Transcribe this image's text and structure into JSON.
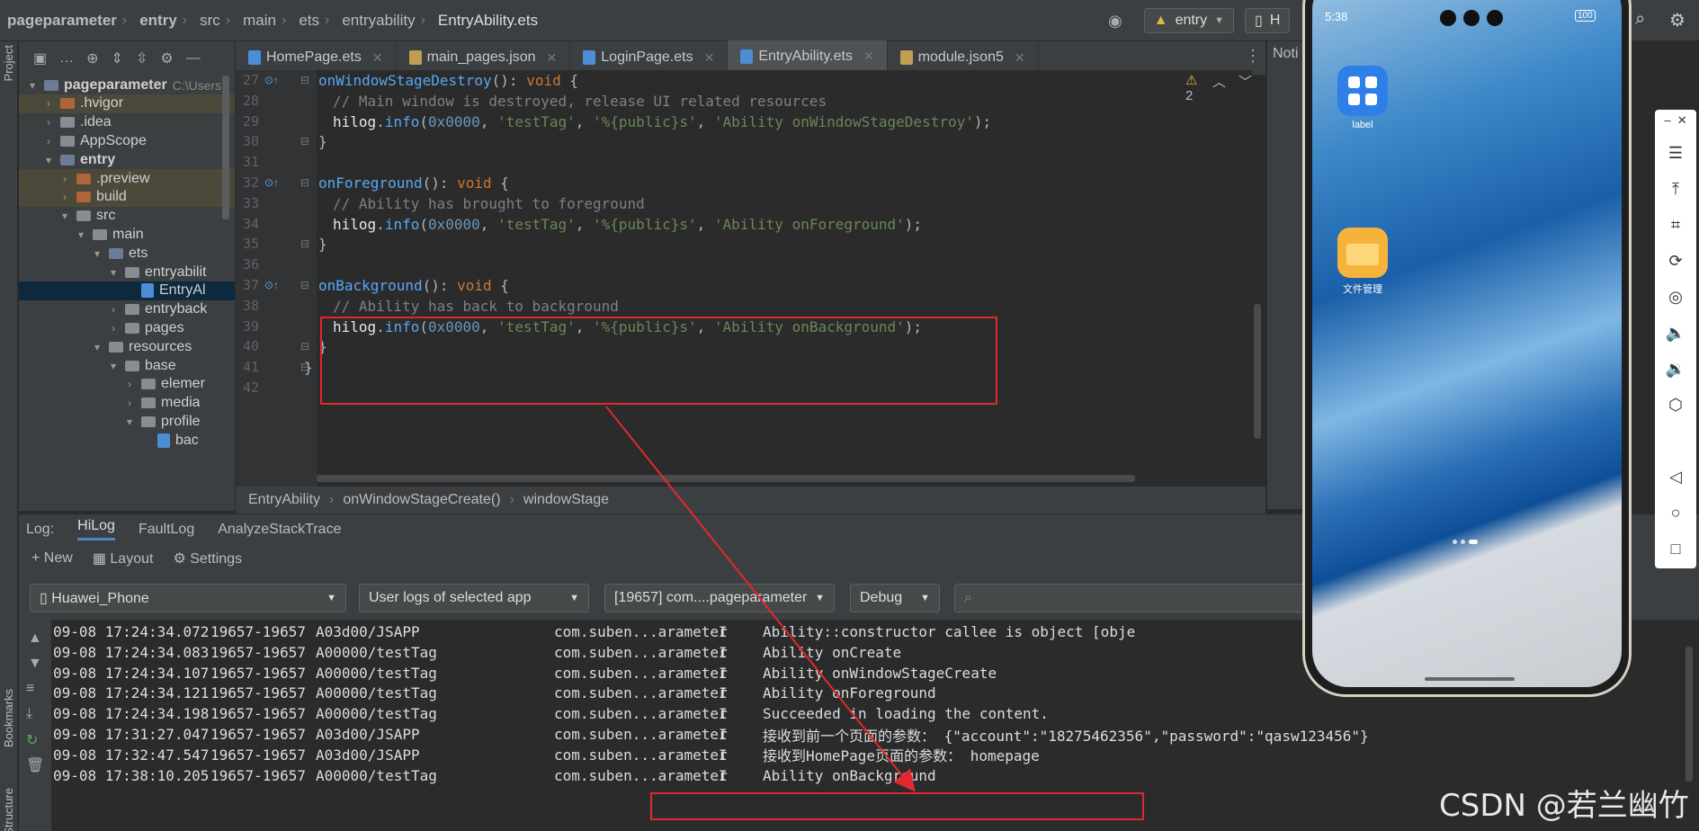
{
  "breadcrumb": [
    "pageparameter",
    "entry",
    "src",
    "main",
    "ets",
    "entryability",
    "EntryAbility.ets"
  ],
  "top_right": {
    "run_config": "entry",
    "device_short": "H"
  },
  "left_strip": {
    "project": "Project",
    "bookmarks": "Bookmarks",
    "structure": "Structure"
  },
  "project_tree": [
    {
      "label": "pageparameter",
      "extra": "C:\\Users",
      "depth": 0,
      "arrow": "▾",
      "icon": "folder-blue",
      "bold": true
    },
    {
      "label": ".hvigor",
      "depth": 1,
      "arrow": "›",
      "icon": "folder-orange",
      "hl": true
    },
    {
      "label": ".idea",
      "depth": 1,
      "arrow": "›",
      "icon": "folder-gray"
    },
    {
      "label": "AppScope",
      "depth": 1,
      "arrow": "›",
      "icon": "folder-gray"
    },
    {
      "label": "entry",
      "depth": 1,
      "arrow": "▾",
      "icon": "folder-blue",
      "bold": true
    },
    {
      "label": ".preview",
      "depth": 2,
      "arrow": "›",
      "icon": "folder-orange",
      "hl": true
    },
    {
      "label": "build",
      "depth": 2,
      "arrow": "›",
      "icon": "folder-orange",
      "hl": true
    },
    {
      "label": "src",
      "depth": 2,
      "arrow": "▾",
      "icon": "folder-gray"
    },
    {
      "label": "main",
      "depth": 3,
      "arrow": "▾",
      "icon": "folder-gray"
    },
    {
      "label": "ets",
      "depth": 4,
      "arrow": "▾",
      "icon": "folder-blue"
    },
    {
      "label": "entryabilit",
      "depth": 5,
      "arrow": "▾",
      "icon": "folder-gray"
    },
    {
      "label": "EntryAl",
      "depth": 6,
      "arrow": "",
      "icon": "file",
      "sel": true
    },
    {
      "label": "entryback",
      "depth": 5,
      "arrow": "›",
      "icon": "folder-gray"
    },
    {
      "label": "pages",
      "depth": 5,
      "arrow": "›",
      "icon": "folder-gray"
    },
    {
      "label": "resources",
      "depth": 4,
      "arrow": "▾",
      "icon": "folder-gray"
    },
    {
      "label": "base",
      "depth": 5,
      "arrow": "▾",
      "icon": "folder-gray"
    },
    {
      "label": "elemer",
      "depth": 6,
      "arrow": "›",
      "icon": "folder-gray"
    },
    {
      "label": "media",
      "depth": 6,
      "arrow": "›",
      "icon": "folder-gray"
    },
    {
      "label": "profile",
      "depth": 6,
      "arrow": "▾",
      "icon": "folder-gray"
    },
    {
      "label": "bac",
      "depth": 7,
      "arrow": "",
      "icon": "file"
    }
  ],
  "tabs": [
    {
      "label": "HomePage.ets",
      "active": false
    },
    {
      "label": "main_pages.json",
      "active": false
    },
    {
      "label": "LoginPage.ets",
      "active": false
    },
    {
      "label": "EntryAbility.ets",
      "active": true
    },
    {
      "label": "module.json5",
      "active": false
    }
  ],
  "code_lines": [
    {
      "n": "27",
      "html": [
        [
          "fn",
          "onWindowStageDestroy"
        ],
        [
          "",
          "(): "
        ],
        [
          "k",
          "void"
        ],
        [
          "",
          " {"
        ]
      ],
      "indent": 0
    },
    {
      "n": "28",
      "html": [
        [
          "c",
          "// Main window is destroyed, release UI related resources"
        ]
      ],
      "indent": 1
    },
    {
      "n": "29",
      "html": [
        [
          "id",
          "hilog"
        ],
        [
          "",
          "."
        ],
        [
          "m",
          "info"
        ],
        [
          "",
          "("
        ],
        [
          "n",
          "0x0000"
        ],
        [
          "",
          ", "
        ],
        [
          "s",
          "'testTag'"
        ],
        [
          "",
          ", "
        ],
        [
          "s",
          "'%{public}s'"
        ],
        [
          "",
          ", "
        ],
        [
          "s",
          "'Ability onWindowStageDestroy'"
        ],
        [
          "",
          ");"
        ]
      ],
      "indent": 1
    },
    {
      "n": "30",
      "html": [
        [
          "",
          "}"
        ]
      ],
      "indent": 0
    },
    {
      "n": "31",
      "html": [],
      "indent": 0
    },
    {
      "n": "32",
      "html": [
        [
          "fn",
          "onForeground"
        ],
        [
          "",
          "(): "
        ],
        [
          "k",
          "void"
        ],
        [
          "",
          " {"
        ]
      ],
      "indent": 0
    },
    {
      "n": "33",
      "html": [
        [
          "c",
          "// Ability has brought to foreground"
        ]
      ],
      "indent": 1
    },
    {
      "n": "34",
      "html": [
        [
          "id",
          "hilog"
        ],
        [
          "",
          "."
        ],
        [
          "m",
          "info"
        ],
        [
          "",
          "("
        ],
        [
          "n",
          "0x0000"
        ],
        [
          "",
          ", "
        ],
        [
          "s",
          "'testTag'"
        ],
        [
          "",
          ", "
        ],
        [
          "s",
          "'%{public}s'"
        ],
        [
          "",
          ", "
        ],
        [
          "s",
          "'Ability onForeground'"
        ],
        [
          "",
          ");"
        ]
      ],
      "indent": 1
    },
    {
      "n": "35",
      "html": [
        [
          "",
          "}"
        ]
      ],
      "indent": 0
    },
    {
      "n": "36",
      "html": [],
      "indent": 0
    },
    {
      "n": "37",
      "html": [
        [
          "fn",
          "onBackground"
        ],
        [
          "",
          "(): "
        ],
        [
          "k",
          "void"
        ],
        [
          "",
          " {"
        ]
      ],
      "indent": 0
    },
    {
      "n": "38",
      "html": [
        [
          "c",
          "// Ability has back to background"
        ]
      ],
      "indent": 1
    },
    {
      "n": "39",
      "html": [
        [
          "id",
          "hilog"
        ],
        [
          "",
          "."
        ],
        [
          "m",
          "info"
        ],
        [
          "",
          "("
        ],
        [
          "n",
          "0x0000"
        ],
        [
          "",
          ", "
        ],
        [
          "s",
          "'testTag'"
        ],
        [
          "",
          ", "
        ],
        [
          "s",
          "'%{public}s'"
        ],
        [
          "",
          ", "
        ],
        [
          "s",
          "'Ability onBackground'"
        ],
        [
          "",
          ");"
        ]
      ],
      "indent": 1
    },
    {
      "n": "40",
      "html": [
        [
          "",
          "}"
        ]
      ],
      "indent": 0
    },
    {
      "n": "41",
      "html": [
        [
          "",
          "}"
        ]
      ],
      "indent": -1
    },
    {
      "n": "42",
      "html": [],
      "indent": 0
    }
  ],
  "inspection": {
    "warnings": "2"
  },
  "editor_breadcrumb": [
    "EntryAbility",
    "onWindowStageCreate()",
    "windowStage"
  ],
  "notifications_label": "Noti",
  "log": {
    "label": "Log:",
    "tabs": [
      "HiLog",
      "FaultLog",
      "AnalyzeStackTrace"
    ],
    "tools": {
      "new": "New",
      "layout": "Layout",
      "settings": "Settings"
    },
    "filters": {
      "device": "Huawei_Phone",
      "scope": "User logs of selected app",
      "process": "[19657] com....pageparameter",
      "level": "Debug",
      "search_placeholder": ""
    },
    "rows": [
      {
        "time": "09-08 17:24:34.072",
        "pid": "19657-19657",
        "tag": "A03d00/JSAPP",
        "pkg": "com.suben...arameter",
        "lvl": "I",
        "msg": "Ability::constructor callee is object [obje"
      },
      {
        "time": "09-08 17:24:34.083",
        "pid": "19657-19657",
        "tag": "A00000/testTag",
        "pkg": "com.suben...arameter",
        "lvl": "I",
        "msg": "Ability onCreate"
      },
      {
        "time": "09-08 17:24:34.107",
        "pid": "19657-19657",
        "tag": "A00000/testTag",
        "pkg": "com.suben...arameter",
        "lvl": "I",
        "msg": "Ability onWindowStageCreate"
      },
      {
        "time": "09-08 17:24:34.121",
        "pid": "19657-19657",
        "tag": "A00000/testTag",
        "pkg": "com.suben...arameter",
        "lvl": "I",
        "msg": "Ability onForeground"
      },
      {
        "time": "09-08 17:24:34.198",
        "pid": "19657-19657",
        "tag": "A00000/testTag",
        "pkg": "com.suben...arameter",
        "lvl": "I",
        "msg": "Succeeded in loading the content."
      },
      {
        "time": "09-08 17:31:27.047",
        "pid": "19657-19657",
        "tag": "A03d00/JSAPP",
        "pkg": "com.suben...arameter",
        "lvl": "I",
        "msg": "接收到前一个页面的参数： {\"account\":\"18275462356\",\"password\":\"qasw123456\"}"
      },
      {
        "time": "09-08 17:32:47.547",
        "pid": "19657-19657",
        "tag": "A03d00/JSAPP",
        "pkg": "com.suben...arameter",
        "lvl": "I",
        "msg": "接收到HomePage页面的参数： homepage"
      },
      {
        "time": "09-08 17:38:10.205",
        "pid": "19657-19657",
        "tag": "A00000/testTag",
        "pkg": "com.suben...arameter",
        "lvl": "I",
        "msg": "Ability onBackground"
      }
    ]
  },
  "phone": {
    "time": "5:38",
    "battery": "100",
    "apps": [
      {
        "name": "label",
        "color": "#2f7fe8"
      },
      {
        "name": "文件管理",
        "color": "#f6b33c"
      }
    ]
  },
  "watermark": "CSDN @若兰幽竹",
  "colors": {
    "accent": "#4a88c7",
    "annotation": "#e0292f"
  }
}
